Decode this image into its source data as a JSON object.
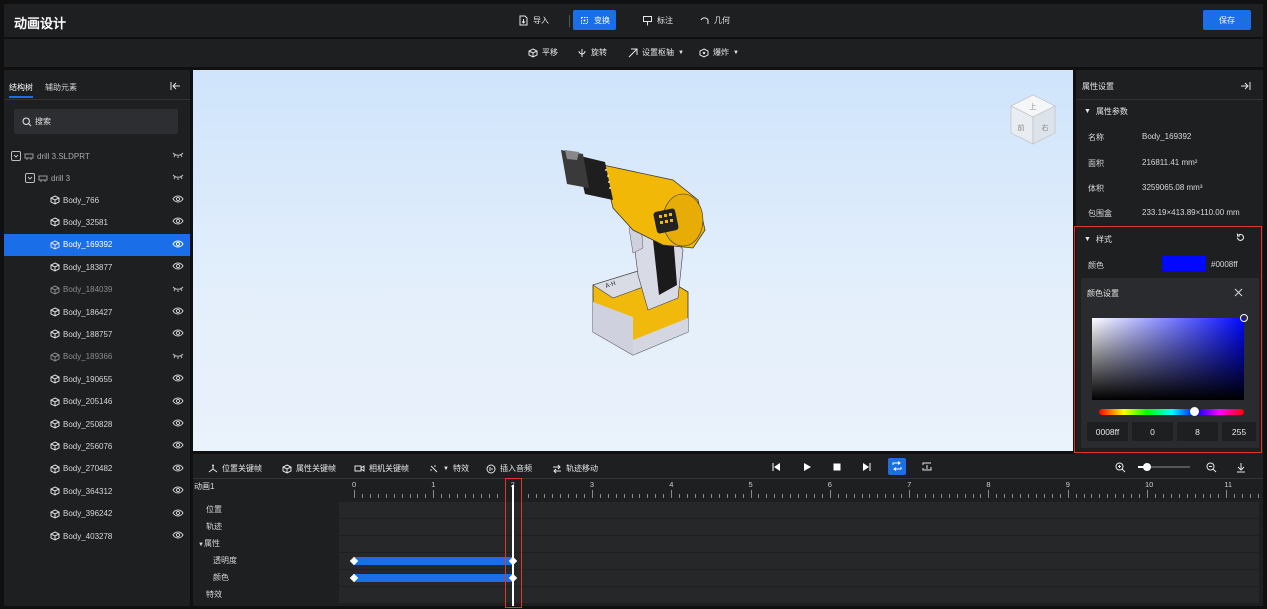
{
  "header": {
    "title": "动画设计",
    "tools": [
      {
        "label": "导入",
        "icon": "import-icon"
      },
      {
        "label": "变换",
        "icon": "transform-icon",
        "active": true
      },
      {
        "label": "标注",
        "icon": "annotate-icon"
      },
      {
        "label": "几何",
        "icon": "geometry-icon"
      }
    ],
    "save_label": "保存"
  },
  "subtoolbar": {
    "translate": "平移",
    "rotate": "旋转",
    "set_axis": "设置枢轴",
    "explode": "爆炸"
  },
  "left": {
    "tab_structure": "结构树",
    "tab_aux": "辅助元素",
    "search_placeholder": "搜索",
    "root": "drill 3.SLDPRT",
    "assembly": "drill 3",
    "bodies": [
      {
        "name": "Body_766",
        "visible": true
      },
      {
        "name": "Body_32581",
        "visible": true
      },
      {
        "name": "Body_169392",
        "visible": true,
        "selected": true
      },
      {
        "name": "Body_183877",
        "visible": true
      },
      {
        "name": "Body_184039",
        "visible": false
      },
      {
        "name": "Body_186427",
        "visible": true
      },
      {
        "name": "Body_188757",
        "visible": true
      },
      {
        "name": "Body_189366",
        "visible": false
      },
      {
        "name": "Body_190655",
        "visible": true
      },
      {
        "name": "Body_205146",
        "visible": true
      },
      {
        "name": "Body_250828",
        "visible": true
      },
      {
        "name": "Body_256076",
        "visible": true
      },
      {
        "name": "Body_270482",
        "visible": true
      },
      {
        "name": "Body_364312",
        "visible": true
      },
      {
        "name": "Body_396242",
        "visible": true
      },
      {
        "name": "Body_403278",
        "visible": true
      }
    ]
  },
  "viewcube": {
    "top": "上",
    "front": "前",
    "right": "右"
  },
  "right": {
    "title": "属性设置",
    "params_section": "属性参数",
    "props": [
      {
        "key": "名称",
        "value": "Body_169392"
      },
      {
        "key": "面积",
        "value": "216811.41 mm²"
      },
      {
        "key": "体积",
        "value": "3259065.08 mm³"
      },
      {
        "key": "包围盒",
        "value": "233.19×413.89×110.00 mm"
      }
    ],
    "style_section": "样式",
    "color_label": "颜色",
    "color_hex": "#0008ff",
    "color_popup_title": "颜色设置",
    "color_fields": [
      "0008ff",
      "0",
      "8",
      "255"
    ],
    "hue_position": 0.66
  },
  "timeline": {
    "tools": [
      "位置关键帧",
      "属性关键帧",
      "相机关键帧",
      "特效",
      "插入音频",
      "轨迹移动"
    ],
    "animation_name": "动画1",
    "rows": [
      "位置",
      "轨迹",
      "属性",
      "透明度",
      "颜色",
      "特效"
    ],
    "ruler": [
      "0",
      "1",
      "2",
      "3",
      "4",
      "5",
      "6",
      "7",
      "8",
      "9",
      "10",
      "11"
    ],
    "playhead_time": 2,
    "keyframes": {
      "opacity": [
        0,
        2
      ],
      "color": [
        0,
        2
      ]
    }
  },
  "colors": {
    "accent": "#1a6ee8",
    "highlight": "#e0352b",
    "swatch": "#0008ff"
  }
}
